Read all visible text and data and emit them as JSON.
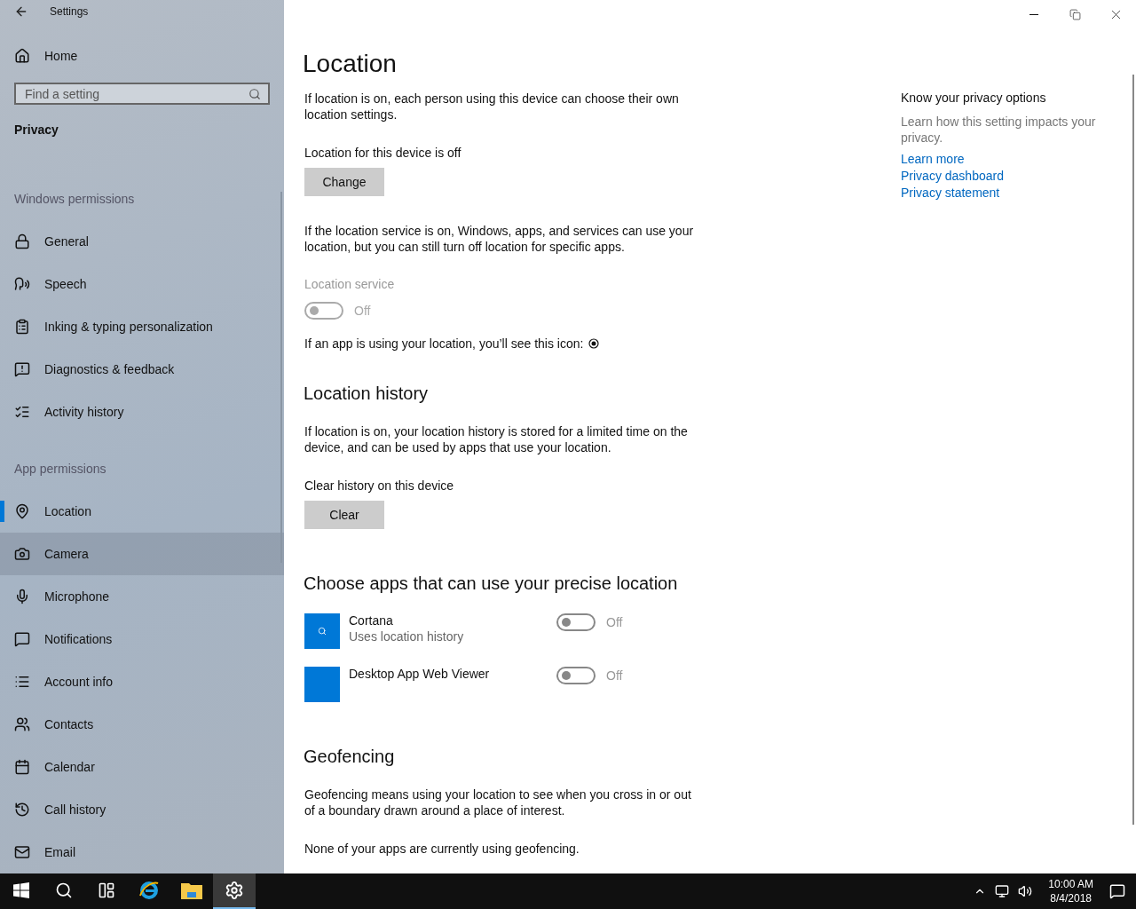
{
  "window": {
    "title": "Settings"
  },
  "sidebar": {
    "home": "Home",
    "search": {
      "placeholder": "Find a setting"
    },
    "category": "Privacy",
    "groups": [
      {
        "heading": "Windows permissions",
        "items": [
          {
            "label": "General",
            "selected": false,
            "hovered": false
          },
          {
            "label": "Speech",
            "selected": false,
            "hovered": false
          },
          {
            "label": "Inking & typing personalization",
            "selected": false,
            "hovered": false
          },
          {
            "label": "Diagnostics & feedback",
            "selected": false,
            "hovered": false
          },
          {
            "label": "Activity history",
            "selected": false,
            "hovered": false
          }
        ]
      },
      {
        "heading": "App permissions",
        "items": [
          {
            "label": "Location",
            "selected": true,
            "hovered": false
          },
          {
            "label": "Camera",
            "selected": false,
            "hovered": true
          },
          {
            "label": "Microphone",
            "selected": false,
            "hovered": false
          },
          {
            "label": "Notifications",
            "selected": false,
            "hovered": false
          },
          {
            "label": "Account info",
            "selected": false,
            "hovered": false
          },
          {
            "label": "Contacts",
            "selected": false,
            "hovered": false
          },
          {
            "label": "Calendar",
            "selected": false,
            "hovered": false
          },
          {
            "label": "Call history",
            "selected": false,
            "hovered": false
          },
          {
            "label": "Email",
            "selected": false,
            "hovered": false
          }
        ]
      }
    ]
  },
  "page": {
    "title": "Location",
    "intro": "If location is on, each person using this device can choose their own location settings.",
    "device_status": "Location for this device is off",
    "change_button": "Change",
    "service_text": "If the location service is on, Windows, apps, and services can use your location, but you can still turn off location for specific apps.",
    "service": {
      "label": "Location service",
      "on": false,
      "disabled": true,
      "state": "Off"
    },
    "icon_note": "If an app is using your location, you’ll see this icon:",
    "history": {
      "title": "Location history",
      "text": "If location is on, your location history is stored for a limited time on the device, and can be used by apps that use your location.",
      "clear_label": "Clear history on this device",
      "clear_button": "Clear"
    },
    "apps": {
      "title": "Choose apps that can use your precise location",
      "items": [
        {
          "name": "Cortana",
          "detail": "Uses location history",
          "on": false,
          "state": "Off"
        },
        {
          "name": "Desktop App Web Viewer",
          "on": false,
          "state": "Off"
        }
      ]
    },
    "geofencing": {
      "title": "Geofencing",
      "text": "Geofencing means using your location to see when you cross in or out of a boundary drawn around a place of interest.",
      "status": "None of your apps are currently using geofencing."
    }
  },
  "aside": {
    "title": "Know your privacy options",
    "text": "Learn how this setting impacts your privacy.",
    "links": [
      "Learn more",
      "Privacy dashboard",
      "Privacy statement"
    ]
  },
  "taskbar": {
    "apps": [
      {
        "selected": false
      },
      {
        "selected": false
      },
      {
        "selected": false
      },
      {
        "selected": false
      },
      {
        "selected": false
      },
      {
        "selected": true
      }
    ],
    "time": "10:00 AM",
    "date": "8/4/2018"
  }
}
